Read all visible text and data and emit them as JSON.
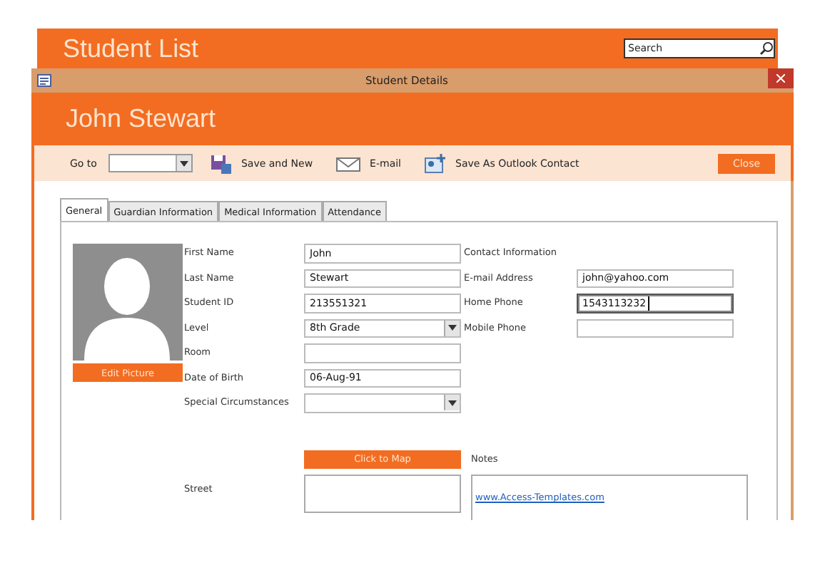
{
  "app": {
    "title": "Student List",
    "search": {
      "placeholder": "Search"
    }
  },
  "dialog": {
    "title": "Student Details",
    "header": "John Stewart",
    "toolbar": {
      "goto_label": "Go to",
      "actions": [
        {
          "label": "Save and New",
          "kind": "save"
        },
        {
          "label": "E-mail",
          "kind": "email"
        },
        {
          "label": "Save As Outlook Contact",
          "kind": "contact"
        }
      ],
      "close": "Close"
    },
    "tabs": [
      {
        "label": "General",
        "selected": true
      },
      {
        "label": "Guardian Information",
        "selected": false
      },
      {
        "label": "Medical Information",
        "selected": false
      },
      {
        "label": "Attendance",
        "selected": false
      }
    ],
    "picture_button": "Edit Picture",
    "fields": [
      {
        "label": "First Name",
        "value": "John",
        "kind": "text",
        "focused": false
      },
      {
        "label": "Last Name",
        "value": "Stewart",
        "kind": "text",
        "focused": false
      },
      {
        "label": "Student ID",
        "value": "213551321",
        "kind": "text",
        "focused": false
      },
      {
        "label": "Level",
        "value": "8th Grade",
        "kind": "dropdown",
        "focused": false
      },
      {
        "label": "Room",
        "kind": "text",
        "focused": false
      },
      {
        "label": "Date of Birth",
        "value": "06-Aug-91",
        "kind": "text",
        "focused": false
      },
      {
        "label": "Special Circumstances",
        "kind": "dropdown",
        "focused": false
      }
    ],
    "contact": {
      "heading": "Contact Information",
      "fields": [
        {
          "label": "E-mail Address",
          "value": "john@yahoo.com",
          "focused": false
        },
        {
          "label": "Home Phone",
          "value": "1543113232",
          "focused": true
        },
        {
          "label": "Mobile Phone",
          "focused": false
        }
      ]
    },
    "map_button": "Click to Map",
    "street": {
      "label": "Street"
    },
    "notes": {
      "label": "Notes",
      "link": "www.Access-Templates.com"
    }
  }
}
